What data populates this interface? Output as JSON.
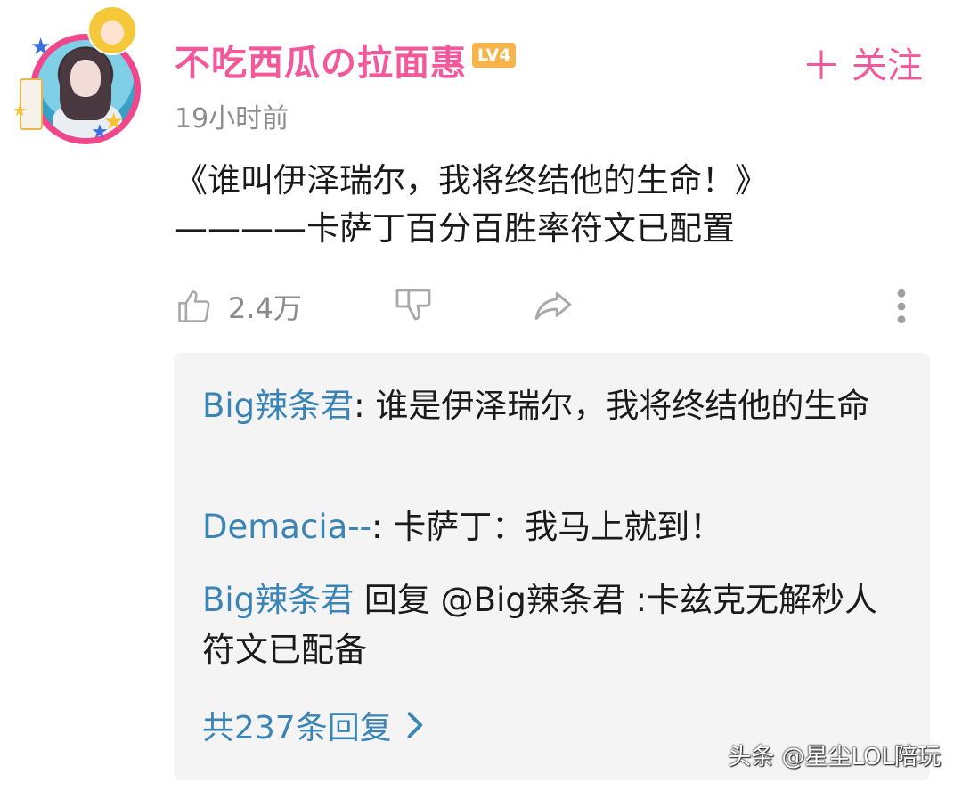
{
  "post": {
    "username": "不吃西瓜の拉面惠",
    "level": "LV4",
    "follow_label": "关注",
    "time": "19小时前",
    "content_line1": "《谁叫伊泽瑞尔，我将终结他的生命！》",
    "content_line2": "————卡萨丁百分百胜率符文已配置",
    "like_count": "2.4万"
  },
  "replies": [
    {
      "author": "Big辣条君",
      "separator": ": ",
      "text": "谁是伊泽瑞尔，我将终结他的生命"
    },
    {
      "author": "Demacia--",
      "separator": ": ",
      "text": "卡萨丁：我马上就到！"
    },
    {
      "author": "Big辣条君",
      "separator": " ",
      "text": "回复 @Big辣条君 :卡兹克无解秒人符文已配备"
    }
  ],
  "more_replies_label": "共237条回复",
  "watermark": "头条 @星尘LOL陪玩",
  "colors": {
    "username": "#f3589a",
    "reply_author": "#3a85b6",
    "level_badge": "#f7b44a",
    "avatar_ring": "#f0468c"
  },
  "icons": [
    "thumbs-up-icon",
    "thumbs-down-icon",
    "share-arrow-icon",
    "more-vertical-icon",
    "plus-icon",
    "chevron-right-icon"
  ]
}
